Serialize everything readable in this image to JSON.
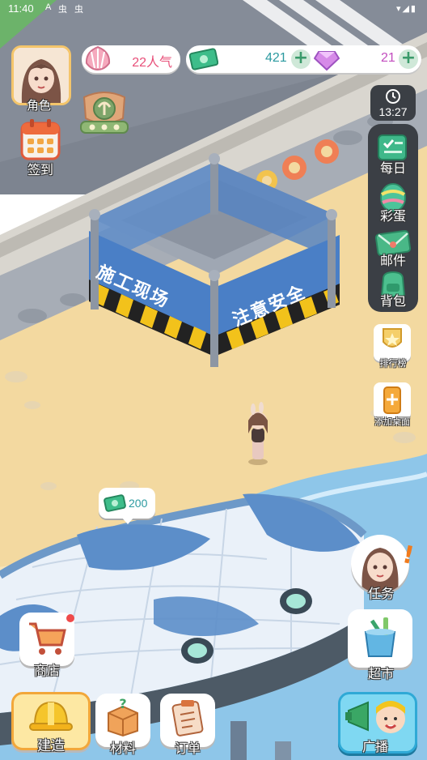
{
  "status_bar": {
    "time": "11:40",
    "notif_a": "A",
    "notif_b": "虫",
    "notif_c": "虫"
  },
  "profile": {
    "label": "角色"
  },
  "signin": {
    "label": "签到"
  },
  "popularity": {
    "value": "22人气"
  },
  "cash": {
    "value": "421"
  },
  "gems": {
    "value": "21"
  },
  "timer": {
    "value": "13:27"
  },
  "right_rail": {
    "daily": "每日",
    "egg": "彩蛋",
    "mail": "邮件",
    "bag": "背包"
  },
  "ranking": {
    "label": "排行榜"
  },
  "add_desktop": {
    "label": "添加桌面"
  },
  "construction_sign": {
    "line1": "施工现场",
    "line2": "注意安全"
  },
  "reward_bubble": {
    "value": "200"
  },
  "mission": {
    "label": "任务"
  },
  "supermarket": {
    "label": "超市"
  },
  "shop": {
    "label": "商店"
  },
  "bottom_bar": {
    "build": "建造",
    "materials": "材料",
    "orders": "订单",
    "broadcast": "广播"
  },
  "colors": {
    "sand": "#f3d9a0",
    "sea": "#8ec6e9",
    "sign_blue": "#4a7fc6",
    "pink_text": "#e8507a",
    "teal_text": "#2c9aa0"
  }
}
